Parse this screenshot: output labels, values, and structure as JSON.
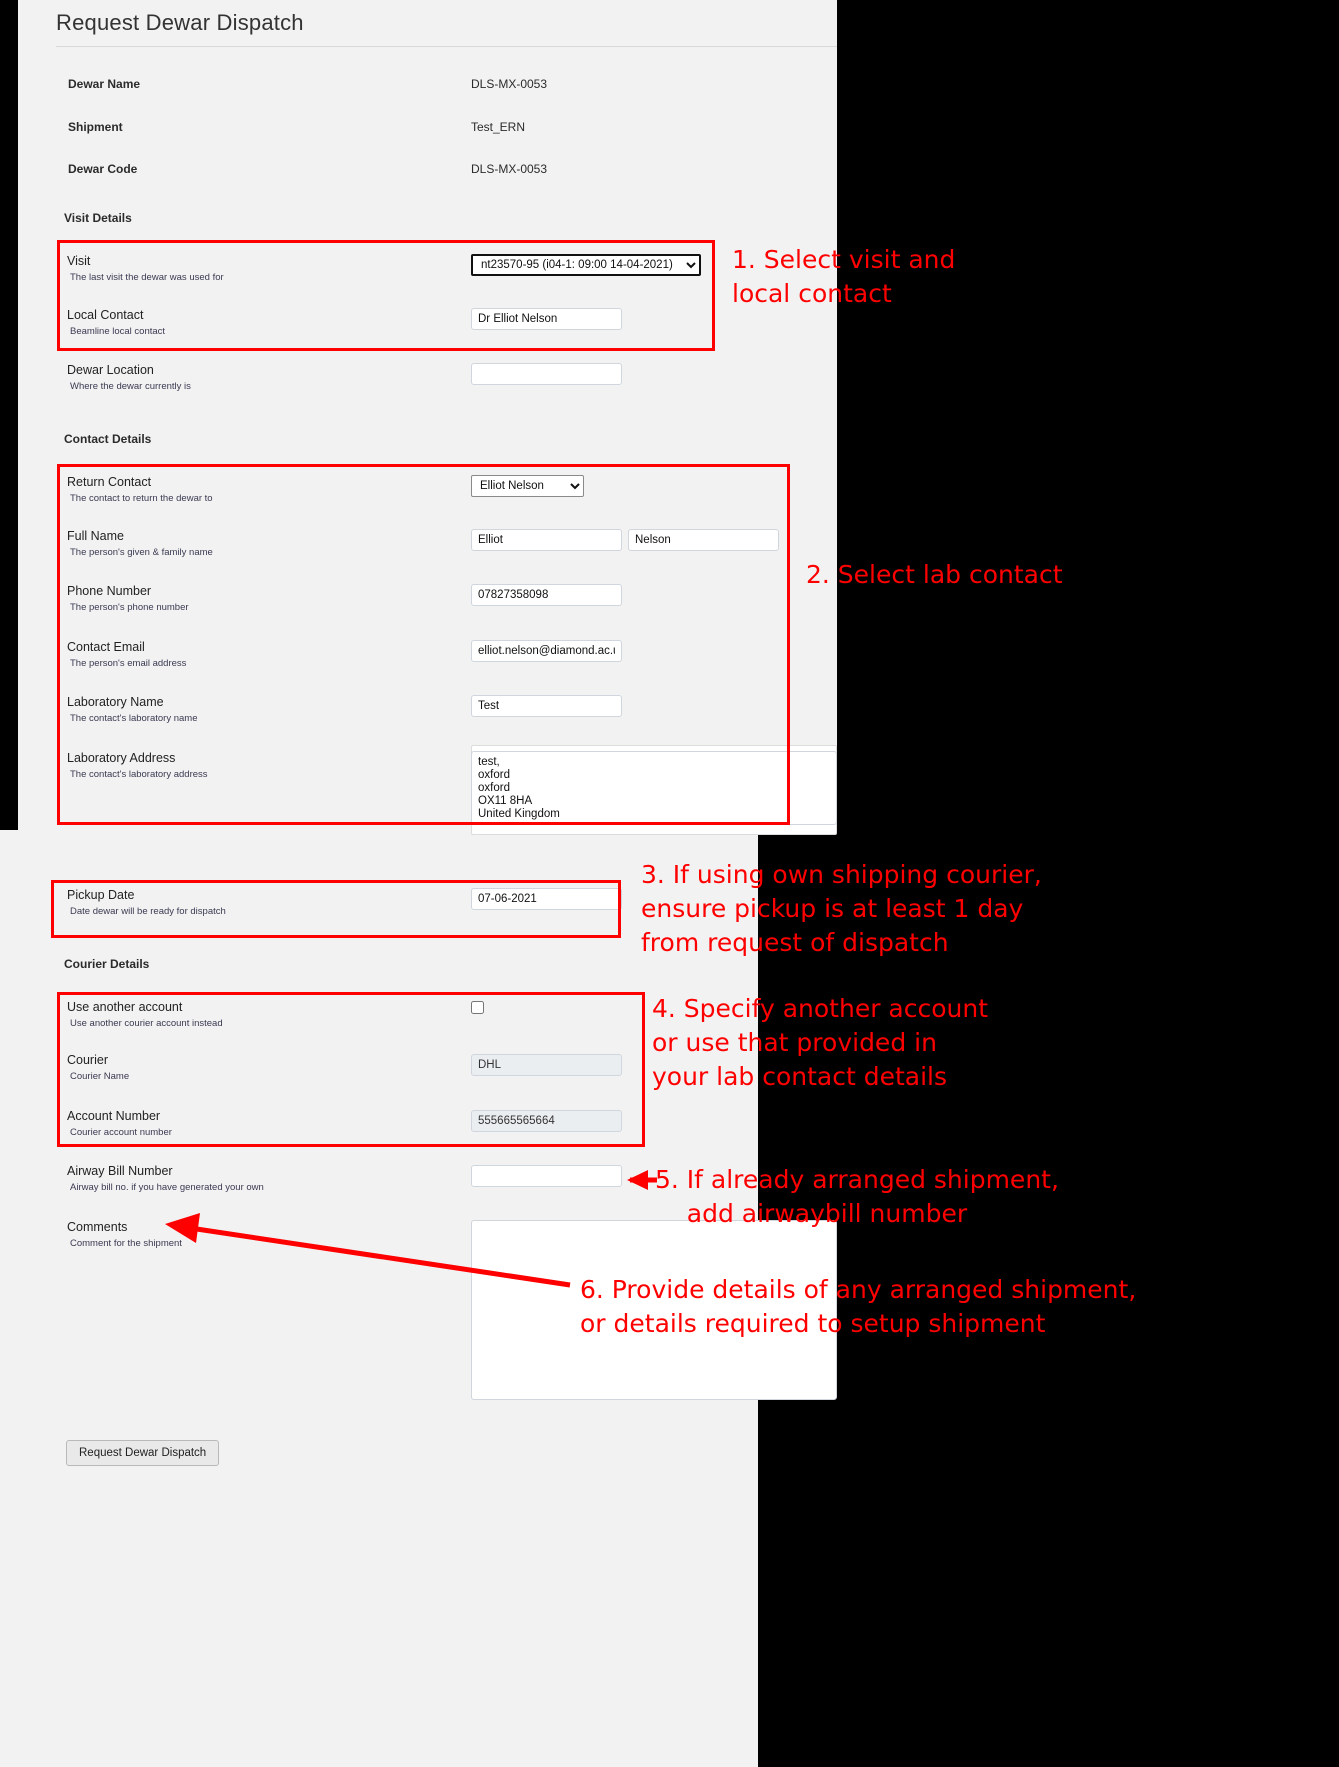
{
  "page": {
    "title": "Request Dewar Dispatch"
  },
  "summary": [
    {
      "label": "Dewar Name",
      "value": "DLS-MX-0053"
    },
    {
      "label": "Shipment",
      "value": "Test_ERN"
    },
    {
      "label": "Dewar Code",
      "value": "DLS-MX-0053"
    }
  ],
  "sections": {
    "visit_details": "Visit Details",
    "contact_details": "Contact Details",
    "courier_details": "Courier Details"
  },
  "fields": {
    "visit": {
      "label": "Visit",
      "hint": "The last visit the dewar was used for",
      "value": "nt23570-95 (i04-1: 09:00 14-04-2021)"
    },
    "local_contact": {
      "label": "Local Contact",
      "hint": "Beamline local contact",
      "value": "Dr Elliot Nelson"
    },
    "dewar_location": {
      "label": "Dewar Location",
      "hint": "Where the dewar currently is",
      "value": ""
    },
    "return_contact": {
      "label": "Return Contact",
      "hint": "The contact to return the dewar to",
      "value": "Elliot Nelson"
    },
    "full_name": {
      "label": "Full Name",
      "hint": "The person's given & family name",
      "first": "Elliot",
      "last": "Nelson"
    },
    "phone_number": {
      "label": "Phone Number",
      "hint": "The person's phone number",
      "value": "07827358098"
    },
    "contact_email": {
      "label": "Contact Email",
      "hint": "The person's email address",
      "value": "elliot.nelson@diamond.ac.u"
    },
    "laboratory_name": {
      "label": "Laboratory Name",
      "hint": "The contact's laboratory name",
      "value": "Test"
    },
    "laboratory_address": {
      "label": "Laboratory Address",
      "hint": "The contact's laboratory address",
      "value": "test,\noxford\noxford\nOX11 8HA\nUnited Kingdom"
    },
    "pickup_date": {
      "label": "Pickup Date",
      "hint": "Date dewar will be ready for dispatch",
      "value": "07-06-2021"
    },
    "use_another_account": {
      "label": "Use another account",
      "hint": "Use another courier account instead",
      "checked": false
    },
    "courier": {
      "label": "Courier",
      "hint": "Courier Name",
      "value": "DHL"
    },
    "account_number": {
      "label": "Account Number",
      "hint": "Courier account number",
      "value": "555665565664"
    },
    "airway_bill_number": {
      "label": "Airway Bill Number",
      "hint": "Airway bill no. if you have generated your own",
      "value": ""
    },
    "comments": {
      "label": "Comments",
      "hint": "Comment for the shipment",
      "value": ""
    }
  },
  "submit_button": {
    "label": "Request Dewar Dispatch"
  },
  "annotations": {
    "color": "#ff0000",
    "items": [
      {
        "id": 1,
        "text": "1. Select visit and\nlocal contact"
      },
      {
        "id": 2,
        "text": "2. Select lab contact"
      },
      {
        "id": 3,
        "text": "3. If using own shipping courier,\nensure pickup is at least 1 day\nfrom request of dispatch"
      },
      {
        "id": 4,
        "text": "4. Specify another account\nor use that provided in\nyour lab contact details"
      },
      {
        "id": 5,
        "text": "5. If already arranged shipment,\n    add airwaybill number"
      },
      {
        "id": 6,
        "text": "6. Provide details of any arranged shipment,\nor details required to setup shipment"
      }
    ]
  }
}
